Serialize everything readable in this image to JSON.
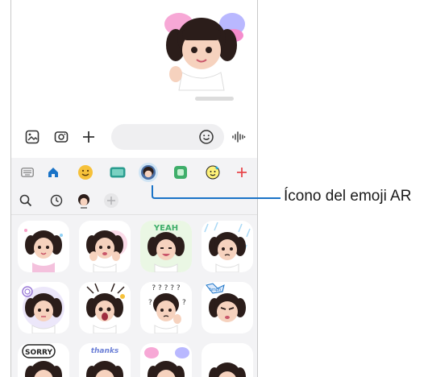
{
  "composer": {
    "icons": [
      "gallery-icon",
      "camera-icon",
      "plus-icon",
      "emoji-icon",
      "voice-icon"
    ]
  },
  "categories": [
    {
      "name": "keyboard-icon"
    },
    {
      "name": "home-icon"
    },
    {
      "name": "emoji-face-icon"
    },
    {
      "name": "gif-icon"
    },
    {
      "name": "ar-emoji-icon",
      "selected": true
    },
    {
      "name": "sticker-icon"
    },
    {
      "name": "bitmoji-icon"
    },
    {
      "name": "add-icon"
    }
  ],
  "subbar": [
    "search-icon",
    "recent-icon",
    "avatar-icon",
    "add-icon"
  ],
  "stickers": [
    {
      "row": 1,
      "col": 1,
      "caption": ""
    },
    {
      "row": 1,
      "col": 2,
      "caption": ""
    },
    {
      "row": 1,
      "col": 3,
      "caption": "YEAH"
    },
    {
      "row": 1,
      "col": 4,
      "caption": ""
    },
    {
      "row": 2,
      "col": 1,
      "caption": ""
    },
    {
      "row": 2,
      "col": 2,
      "caption": ""
    },
    {
      "row": 2,
      "col": 3,
      "caption": "?????"
    },
    {
      "row": 2,
      "col": 4,
      "caption": "hmph"
    },
    {
      "row": 3,
      "col": 1,
      "caption": "SORRY"
    },
    {
      "row": 3,
      "col": 2,
      "caption": "thanks"
    },
    {
      "row": 3,
      "col": 3,
      "caption": ""
    },
    {
      "row": 3,
      "col": 4,
      "caption": ""
    }
  ],
  "callout": {
    "label": "Ícono del emoji AR"
  },
  "colors": {
    "accent": "#1a73c7",
    "selected_bg": "#cfe4f4",
    "plus_red": "#e8474c"
  }
}
